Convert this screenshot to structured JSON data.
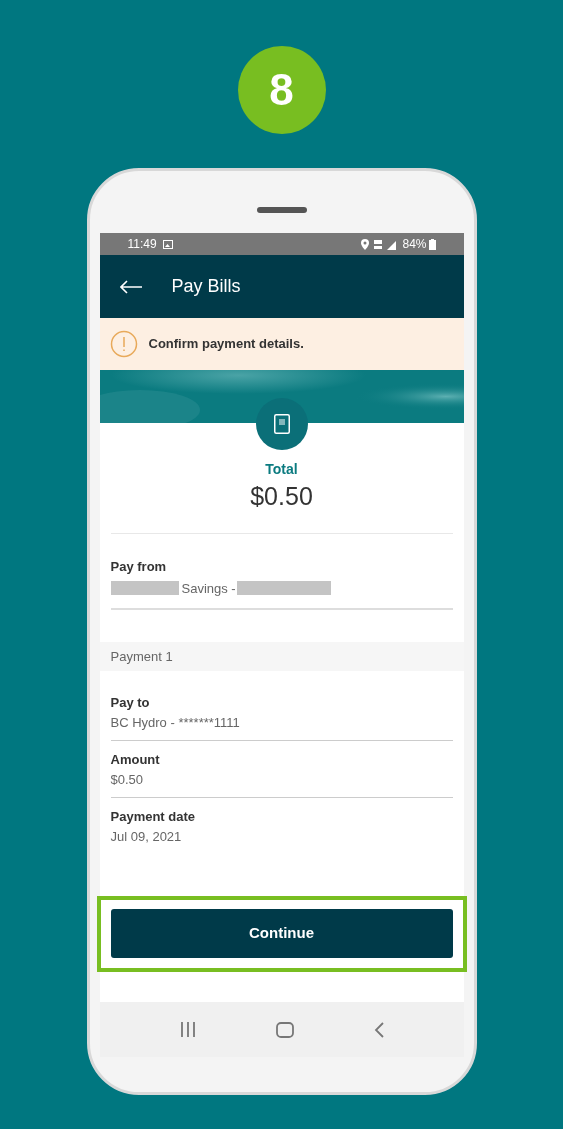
{
  "step_badge": "8",
  "status_bar": {
    "time": "11:49",
    "battery": "84%"
  },
  "header": {
    "title": "Pay Bills"
  },
  "alert": {
    "text": "Confirm payment details."
  },
  "total": {
    "label": "Total",
    "amount": "$0.50"
  },
  "pay_from": {
    "label": "Pay from",
    "value": "Savings -"
  },
  "section": {
    "title": "Payment 1"
  },
  "details": [
    {
      "label": "Pay to",
      "value": "BC Hydro - *******1111"
    },
    {
      "label": "Amount",
      "value": "$0.50"
    },
    {
      "label": "Payment date",
      "value": "Jul 09, 2021"
    }
  ],
  "continue_button": {
    "label": "Continue",
    "highlighted": true
  }
}
